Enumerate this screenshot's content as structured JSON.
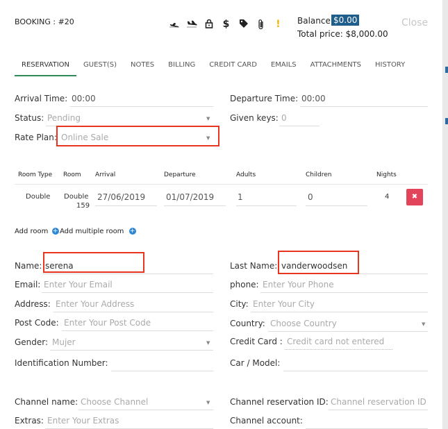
{
  "header": {
    "booking_title": "BOOKING : #20",
    "balance_label": "Balance:",
    "balance_value": "$0.00",
    "total_price": "Total price: $8,000.00",
    "close_label": "Close",
    "icons": [
      "plane-departure-icon",
      "plane-arrival-icon",
      "lock-icon",
      "dollar-icon",
      "tag-icon",
      "paperclip-icon",
      "exclamation-icon"
    ]
  },
  "tabs": [
    {
      "label": "RESERVATION",
      "active": true
    },
    {
      "label": "GUEST(S)"
    },
    {
      "label": "NOTES"
    },
    {
      "label": "BILLING"
    },
    {
      "label": "CREDIT CARD"
    },
    {
      "label": "EMAILS"
    },
    {
      "label": "ATTACHMENTS"
    },
    {
      "label": "HISTORY"
    }
  ],
  "reservation": {
    "arrival_time_label": "Arrival Time:",
    "arrival_time_value": "00:00",
    "departure_time_label": "Departure Time:",
    "departure_time_value": "00:00",
    "status_label": "Status:",
    "status_value": "Pending",
    "given_keys_label": "Given keys:",
    "given_keys_value": "0",
    "rate_plan_label": "Rate Plan:",
    "rate_plan_value": "Online Sale"
  },
  "rooms_table": {
    "headers": [
      "Room Type",
      "Room",
      "Arrival",
      "Departure",
      "Adults",
      "Children",
      "Nights"
    ],
    "row": {
      "room_type": "Double",
      "room_line1": "Double",
      "room_line2": "159",
      "arrival": "27/06/2019",
      "departure": "01/07/2019",
      "adults": "1",
      "children": "0",
      "nights": "4",
      "delete_glyph": "✖"
    }
  },
  "room_actions": {
    "add_room": "Add room",
    "add_multiple_room": "Add multiple room",
    "plus_glyph": "+"
  },
  "guest": {
    "name_label": "Name:",
    "name_value": "serena",
    "last_name_label": "Last Name:",
    "last_name_value": "vanderwoodsen",
    "email_label": "Email:",
    "email_placeholder": "Enter Your Email",
    "phone_label": "phone:",
    "phone_placeholder": "Enter Your Phone",
    "address_label": "Address:",
    "address_placeholder": "Enter Your Address",
    "city_label": "City:",
    "city_placeholder": "Enter Your City",
    "post_code_label": "Post Code:",
    "post_code_placeholder": "Enter Your Post Code",
    "country_label": "Country:",
    "country_placeholder": "Choose Country",
    "gender_label": "Gender:",
    "gender_value": "Mujer",
    "credit_card_label": "Credit Card :",
    "credit_card_value": "Credit card not entered",
    "identification_label": "Identification Number:",
    "car_label": "Car / Model:"
  },
  "channel": {
    "channel_name_label": "Channel name:",
    "channel_name_placeholder": "Choose Channel",
    "channel_res_id_label": "Channel reservation ID:",
    "channel_res_id_placeholder": "Channel reservation ID",
    "extras_label": "Extras:",
    "extras_placeholder": "Enter Your Extras",
    "channel_account_label": "Channel account:"
  },
  "colors": {
    "accent_tab": "#2e8b57",
    "balance_bg": "#1f5d8c",
    "highlight_box": "#e8351f",
    "delete_button": "#e2445c",
    "warning": "#f5b400"
  }
}
